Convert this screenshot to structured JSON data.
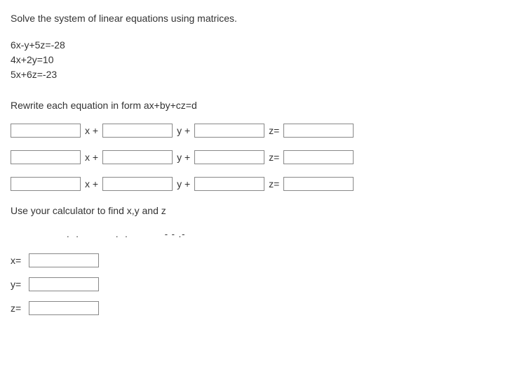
{
  "title": "Solve the system of linear equations using matrices.",
  "equations": {
    "e1": "6x-y+5z=-28",
    "e2": "4x+2y=10",
    "e3": "5x+6z=-23"
  },
  "instruction1": "Rewrite each equation in form ax+by+cz=d",
  "ops": {
    "xplus": "x +",
    "yplus": "y +",
    "zeq": "z="
  },
  "instruction2": "Use your calculator to find x,y and z",
  "dotsrow": ". .   . .         - - . -",
  "answers": {
    "x": "x=",
    "y": "y=",
    "z": "z="
  }
}
